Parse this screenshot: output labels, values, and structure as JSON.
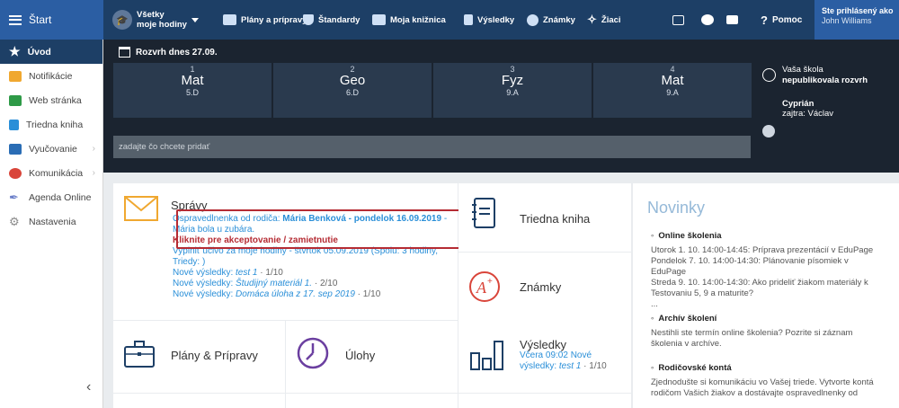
{
  "topbar": {
    "start_label": "Štart",
    "class_selector": {
      "line1": "Všetky",
      "line2": "moje hodiny"
    },
    "nav": [
      {
        "label": "Plány a prípravy",
        "icon": "plans-icon"
      },
      {
        "label": "Štandardy",
        "icon": "shield-icon"
      },
      {
        "label": "Moja knižnica",
        "icon": "library-icon"
      },
      {
        "label": "Výsledky",
        "icon": "chart-icon"
      },
      {
        "label": "Známky",
        "icon": "grades-icon"
      },
      {
        "label": "Žiaci",
        "icon": "students-icon"
      }
    ],
    "help_label": "Pomoc",
    "user": {
      "line1": "Ste prihlásený ako",
      "name": "John Williams"
    }
  },
  "sidebar": {
    "items": [
      {
        "label": "Úvod",
        "icon": "star-icon",
        "color": "#ffffff"
      },
      {
        "label": "Notifikácie",
        "icon": "envelope-icon",
        "color": "#f0a830"
      },
      {
        "label": "Web stránka",
        "icon": "home-icon",
        "color": "#2e9a47"
      },
      {
        "label": "Triedna kniha",
        "icon": "book-icon",
        "color": "#2a8fd8"
      },
      {
        "label": "Vyučovanie",
        "icon": "briefcase-icon",
        "color": "#2a6db5"
      },
      {
        "label": "Komunikácia",
        "icon": "chat-icon",
        "color": "#d9453a"
      },
      {
        "label": "Agenda Online",
        "icon": "pen-icon",
        "color": "#6b7fc9"
      },
      {
        "label": "Nastavenia",
        "icon": "gear-icon",
        "color": "#8a8a8a"
      }
    ]
  },
  "schedule": {
    "title": "Rozvrh dnes 27.09.",
    "lessons": [
      {
        "num": "1",
        "subject": "Mat",
        "class": "5.D"
      },
      {
        "num": "2",
        "subject": "Geo",
        "class": "6.D"
      },
      {
        "num": "3",
        "subject": "Fyz",
        "class": "9.A"
      },
      {
        "num": "4",
        "subject": "Mat",
        "class": "9.A"
      }
    ],
    "school_info": {
      "line1": "Vaša škola",
      "line2": "nepublikovala rozvrh"
    },
    "substitute": {
      "name": "Cyprián",
      "detail": "zajtra: Václav"
    },
    "add_placeholder": "zadajte čo chcete pridať"
  },
  "tiles": {
    "spravy": {
      "title": "Správy",
      "msg_prefix": "Ospravedlnenka od rodiča: ",
      "msg_bold": "Mária Benková - pondelok 16.09.2019",
      "msg_suffix": " - Mária bola u zubára.",
      "msg_action": "Kliknite pre akceptovanie / zamietnutie",
      "line_curriculum": "Vyplniť učivo za moje hodiny - štvrtok 05.09.2019 (Spolu: 3 hodiny, Triedy: )",
      "results": [
        {
          "prefix": "Nové výsledky: ",
          "item": "test 1",
          "score": " · 1/10"
        },
        {
          "prefix": "Nové výsledky: ",
          "item": "Študijný materiál 1.",
          "score": " · 2/10"
        },
        {
          "prefix": "Nové výsledky: ",
          "item": "Domáca úloha z 17. sep 2019",
          "score": " · 1/10"
        }
      ]
    },
    "triedna_kniha": {
      "title": "Triedna kniha"
    },
    "znamky": {
      "title": "Známky"
    },
    "plany": {
      "title": "Plány & Prípravy"
    },
    "ulohy": {
      "title": "Úlohy"
    },
    "vysledky": {
      "title": "Výsledky",
      "sub1": "Včera 09:02 Nové",
      "sub2_prefix": "výsledky: ",
      "sub2_item": "test 1",
      "sub2_score": " · 1/10"
    }
  },
  "news": {
    "title": "Novinky",
    "items": [
      {
        "head": "Online školenia",
        "body": [
          "Utorok 1. 10. 14:00-14:45: Príprava prezentácií v EduPage",
          "Pondelok 7. 10. 14:00-14:30: Plánovanie písomiek v EduPage",
          "Streda 9. 10. 14:00-14:30: Ako prideliť žiakom materiály k Testovaniu 5, 9 a maturite?",
          "..."
        ]
      },
      {
        "head": "Archív školení",
        "body": [
          "Nestihli ste termín online školenia? Pozrite si záznam školenia v archíve."
        ]
      },
      {
        "head": "Rodičovské kontá",
        "body": [
          "Zjednodušte si komunikáciu vo Vašej triede. Vytvorte kontá rodičom Vašich žiakov a dostávajte ospravedlnenky od"
        ]
      }
    ]
  },
  "colors": {
    "topbar": "#1d3f66",
    "accent": "#2a8fd8",
    "alert": "#b52b33"
  }
}
